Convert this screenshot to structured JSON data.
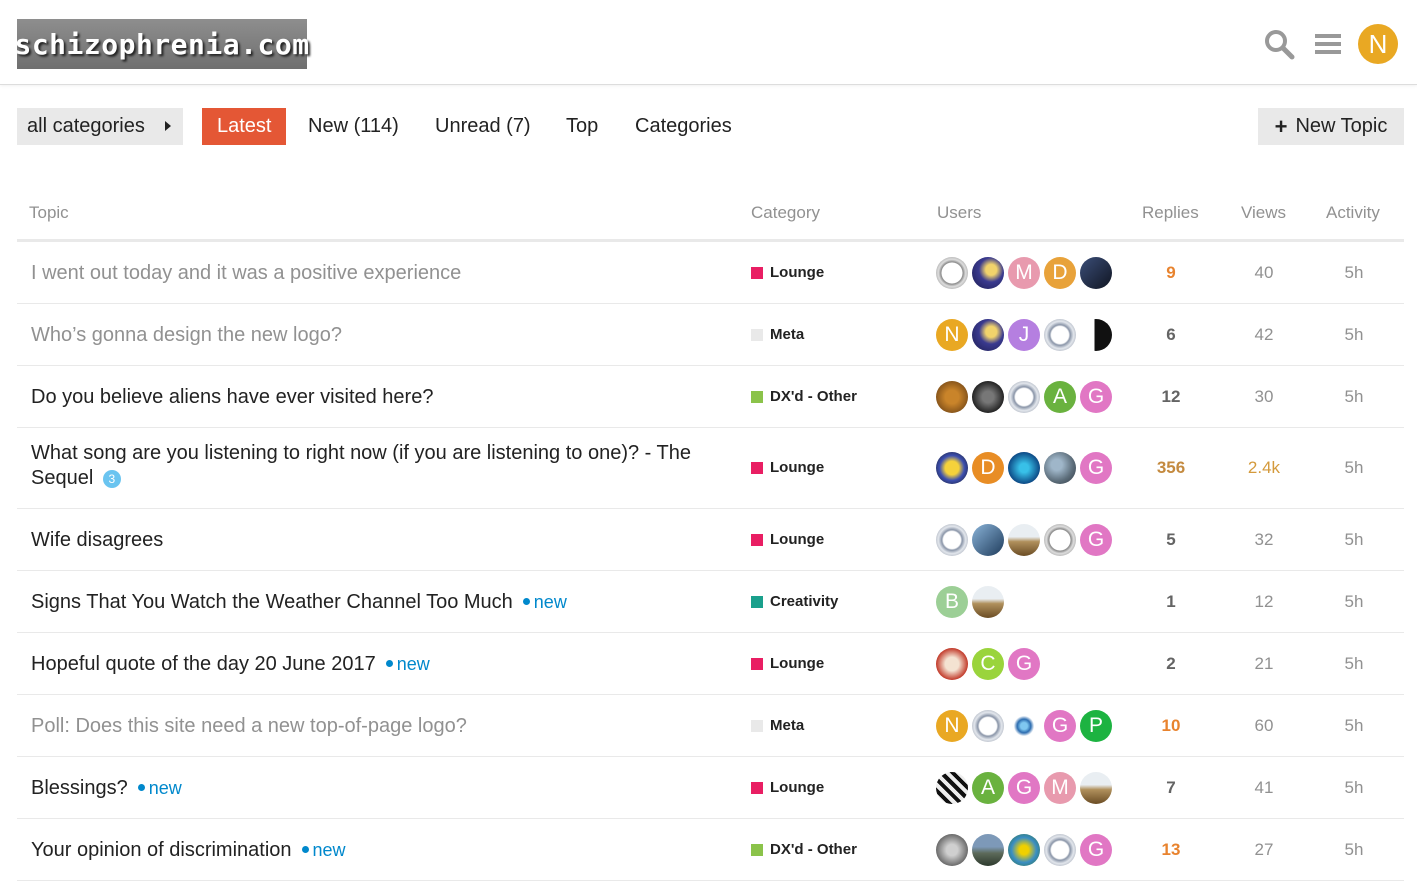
{
  "header": {
    "logo_text": "schizophrenia.com",
    "search_icon": "search-icon",
    "menu_icon": "hamburger-icon",
    "user_avatar_letter": "N"
  },
  "nav": {
    "category_dropdown": "all categories",
    "tabs": [
      {
        "label": "Latest",
        "active": true
      },
      {
        "label": "New (114)"
      },
      {
        "label": "Unread (7)"
      },
      {
        "label": "Top"
      },
      {
        "label": "Categories"
      }
    ],
    "new_topic": "New Topic"
  },
  "columns": {
    "topic": "Topic",
    "category": "Category",
    "users": "Users",
    "replies": "Replies",
    "views": "Views",
    "activity": "Activity"
  },
  "colors": {
    "accent": "#e45735",
    "lounge": "#e91e63",
    "meta": "#e9e9e9",
    "dx_other": "#8bc34a",
    "creativity": "#1aa08c",
    "link_blue": "#0088cc",
    "hot_orange": "#e8832e"
  },
  "topics": [
    {
      "title": "I went out today and it was a positive experience",
      "visited": true,
      "category": "Lounge",
      "replies": "9",
      "views": "40",
      "activity": "5h",
      "users": [
        {
          "type": "img",
          "icon": "clock"
        },
        {
          "type": "img",
          "icon": "moon"
        },
        {
          "type": "letter",
          "letter": "M",
          "color": "#e89aae"
        },
        {
          "type": "letter",
          "letter": "D",
          "color": "#e8a23a"
        },
        {
          "type": "img",
          "icon": "photo-dark"
        }
      ]
    },
    {
      "title": "Who’s gonna design the new logo?",
      "visited": true,
      "category": "Meta",
      "replies": "6",
      "views": "42",
      "activity": "5h",
      "users": [
        {
          "type": "letter",
          "letter": "N",
          "color": "#e9a823"
        },
        {
          "type": "img",
          "icon": "moon"
        },
        {
          "type": "letter",
          "letter": "J",
          "color": "#b57fe0"
        },
        {
          "type": "img",
          "icon": "ring"
        },
        {
          "type": "img",
          "icon": "bird"
        }
      ]
    },
    {
      "title": "Do you believe aliens have ever visited here?",
      "visited": false,
      "category": "DX'd - Other",
      "replies": "12",
      "views": "30",
      "activity": "5h",
      "users": [
        {
          "type": "img",
          "icon": "lion"
        },
        {
          "type": "img",
          "icon": "cat"
        },
        {
          "type": "img",
          "icon": "ring"
        },
        {
          "type": "letter",
          "letter": "A",
          "color": "#6ab23f"
        },
        {
          "type": "letter",
          "letter": "G",
          "color": "#e177c4"
        }
      ]
    },
    {
      "title": "What song are you listening to right now (if you are listening to one)? - The Sequel",
      "visited": false,
      "badge": "3",
      "category": "Lounge",
      "replies": "356",
      "views": "2.4k",
      "activity": "5h",
      "users": [
        {
          "type": "img",
          "icon": "face"
        },
        {
          "type": "letter",
          "letter": "D",
          "color": "#e88d25"
        },
        {
          "type": "img",
          "icon": "blue-fractal"
        },
        {
          "type": "img",
          "icon": "planet"
        },
        {
          "type": "letter",
          "letter": "G",
          "color": "#e177c4"
        }
      ]
    },
    {
      "title": "Wife disagrees",
      "visited": false,
      "category": "Lounge",
      "replies": "5",
      "views": "32",
      "activity": "5h",
      "users": [
        {
          "type": "img",
          "icon": "ring"
        },
        {
          "type": "img",
          "icon": "bird-blue"
        },
        {
          "type": "img",
          "icon": "landscape"
        },
        {
          "type": "img",
          "icon": "clock"
        },
        {
          "type": "letter",
          "letter": "G",
          "color": "#e177c4"
        }
      ]
    },
    {
      "title": "Signs That You Watch the Weather Channel Too Much",
      "visited": false,
      "new": "new",
      "category": "Creativity",
      "replies": "1",
      "views": "12",
      "activity": "5h",
      "users": [
        {
          "type": "letter",
          "letter": "B",
          "color": "#9ccf96"
        },
        {
          "type": "img",
          "icon": "landscape"
        }
      ]
    },
    {
      "title": "Hopeful quote of the day 20 June 2017",
      "visited": false,
      "new": "new",
      "category": "Lounge",
      "replies": "2",
      "views": "21",
      "activity": "5h",
      "users": [
        {
          "type": "img",
          "icon": "santa"
        },
        {
          "type": "letter",
          "letter": "C",
          "color": "#9ad43c"
        },
        {
          "type": "letter",
          "letter": "G",
          "color": "#e177c4"
        }
      ]
    },
    {
      "title": "Poll: Does this site need a new top-of-page logo?",
      "visited": true,
      "category": "Meta",
      "replies": "10",
      "views": "60",
      "activity": "5h",
      "users": [
        {
          "type": "letter",
          "letter": "N",
          "color": "#e9a823"
        },
        {
          "type": "img",
          "icon": "ring"
        },
        {
          "type": "img",
          "icon": "star"
        },
        {
          "type": "letter",
          "letter": "G",
          "color": "#e177c4"
        },
        {
          "type": "letter",
          "letter": "P",
          "color": "#1db341"
        }
      ]
    },
    {
      "title": "Blessings?",
      "visited": false,
      "new": "new",
      "category": "Lounge",
      "replies": "7",
      "views": "41",
      "activity": "5h",
      "users": [
        {
          "type": "img",
          "icon": "zebra"
        },
        {
          "type": "letter",
          "letter": "A",
          "color": "#6ab23f"
        },
        {
          "type": "letter",
          "letter": "G",
          "color": "#e177c4"
        },
        {
          "type": "letter",
          "letter": "M",
          "color": "#e89aae"
        },
        {
          "type": "img",
          "icon": "landscape"
        }
      ]
    },
    {
      "title": "Your opinion of discrimination",
      "visited": false,
      "new": "new",
      "category": "DX'd - Other",
      "replies": "13",
      "views": "27",
      "activity": "5h",
      "users": [
        {
          "type": "img",
          "icon": "portrait"
        },
        {
          "type": "img",
          "icon": "mountain"
        },
        {
          "type": "img",
          "icon": "figure"
        },
        {
          "type": "img",
          "icon": "ring"
        },
        {
          "type": "letter",
          "letter": "G",
          "color": "#e177c4"
        }
      ]
    }
  ]
}
